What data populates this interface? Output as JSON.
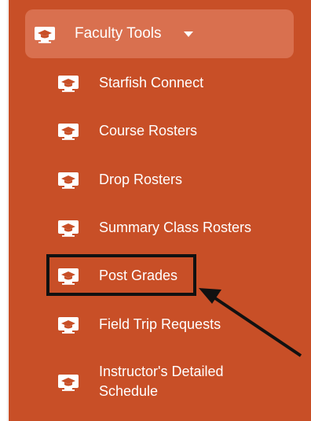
{
  "menu": {
    "parent": {
      "label": "Faculty Tools",
      "icon": "monitor-graduation-cap-icon"
    },
    "items": [
      {
        "label": "Starfish Connect",
        "icon": "monitor-graduation-cap-icon"
      },
      {
        "label": "Course Rosters",
        "icon": "monitor-graduation-cap-icon"
      },
      {
        "label": "Drop Rosters",
        "icon": "monitor-graduation-cap-icon"
      },
      {
        "label": "Summary Class Rosters",
        "icon": "monitor-graduation-cap-icon"
      },
      {
        "label": "Post Grades",
        "icon": "monitor-graduation-cap-icon"
      },
      {
        "label": "Field Trip Requests",
        "icon": "monitor-graduation-cap-icon"
      },
      {
        "label": "Instructor's Detailed Schedule",
        "icon": "monitor-graduation-cap-icon"
      }
    ]
  },
  "colors": {
    "panel": "#c84f27",
    "parent_highlight": "#d9704f",
    "text": "#ffffff",
    "annotation": "#111111"
  }
}
